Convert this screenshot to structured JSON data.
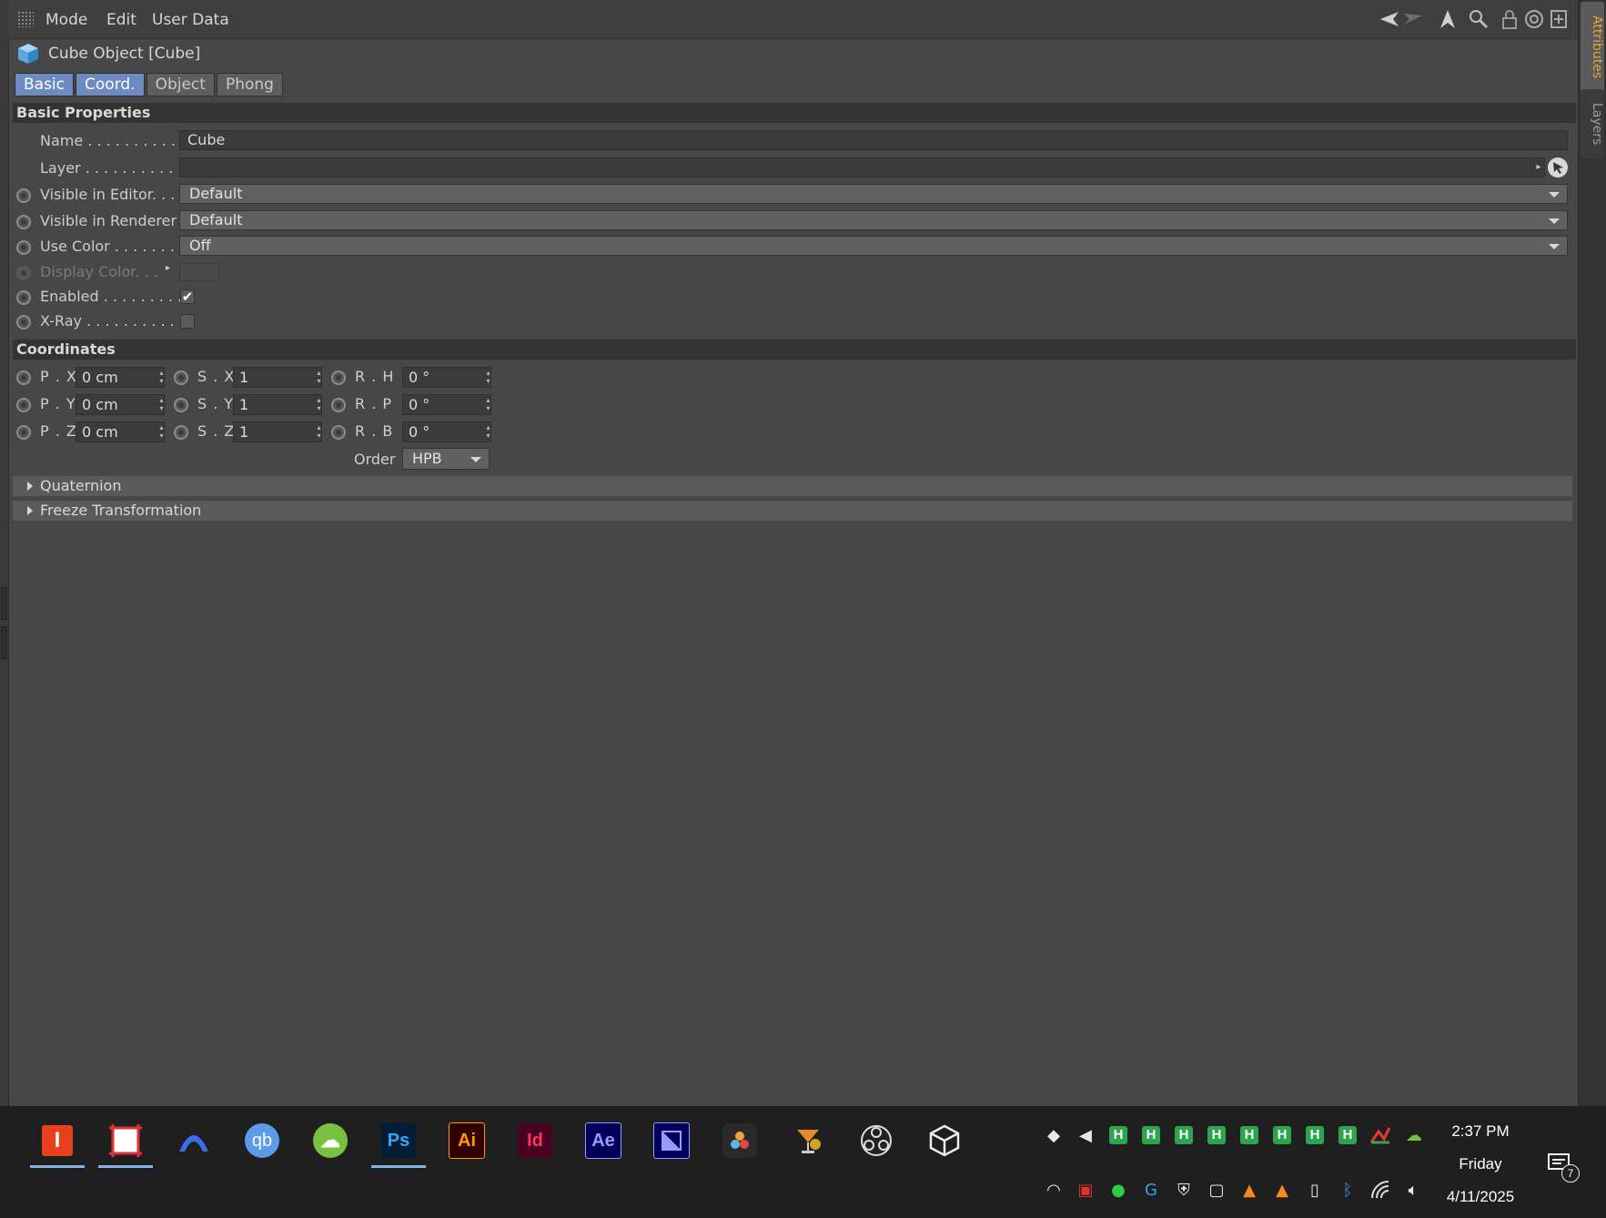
{
  "menu": {
    "items": [
      "Mode",
      "Edit",
      "User Data"
    ]
  },
  "toolbar_icons": [
    "back-arrow-icon",
    "forward-arrow-icon",
    "up-arrow-icon",
    "search-icon",
    "lock-icon",
    "target-icon",
    "new-panel-icon"
  ],
  "side_tabs": {
    "attributes": "Attributes",
    "layers": "Layers"
  },
  "object": {
    "title": "Cube Object [Cube]",
    "icon": "cube-icon"
  },
  "tabs": [
    "Basic",
    "Coord.",
    "Object",
    "Phong"
  ],
  "basic": {
    "header": "Basic Properties",
    "name_label": "Name . . . . . . . . . . .",
    "name_value": "Cube",
    "layer_label": "Layer . . . . . . . . . . . .",
    "layer_value": "",
    "visible_editor_label": "Visible in Editor. . .",
    "visible_editor_value": "Default",
    "visible_renderer_label": "Visible in Renderer",
    "visible_renderer_value": "Default",
    "use_color_label": "Use Color . . . . . . . .",
    "use_color_value": "Off",
    "display_color_label": "Display Color. . .",
    "enabled_label": "Enabled . . . . . . . . .",
    "enabled_checked": true,
    "xray_label": "X-Ray . . . . . . . . . . .",
    "xray_checked": false
  },
  "coords": {
    "header": "Coordinates",
    "position": [
      {
        "label": "P . X",
        "value": "0 cm"
      },
      {
        "label": "P . Y",
        "value": "0 cm"
      },
      {
        "label": "P . Z",
        "value": "0 cm"
      }
    ],
    "scale": [
      {
        "label": "S . X",
        "value": "1"
      },
      {
        "label": "S . Y",
        "value": "1"
      },
      {
        "label": "S . Z",
        "value": "1"
      }
    ],
    "rotation": [
      {
        "label": "R . H",
        "value": "0 °"
      },
      {
        "label": "R . P",
        "value": "0 °"
      },
      {
        "label": "R . B",
        "value": "0 °"
      }
    ],
    "order_label": "Order",
    "order_value": "HPB"
  },
  "groups": {
    "quaternion": "Quaternion",
    "freeze": "Freeze Transformation"
  },
  "taskbar": {
    "apps": [
      "indesign-red-icon",
      "snipping-tool-icon",
      "arc-app-icon",
      "qbittorrent-icon",
      "cloud-sync-icon",
      "photoshop-icon",
      "illustrator-icon",
      "indesign-icon",
      "after-effects-icon",
      "media-encoder-icon",
      "davinci-resolve-icon",
      "cocktail-app-icon",
      "obs-icon",
      "cube-app-icon"
    ],
    "app_labels": {
      "ps": "Ps",
      "ai": "Ai",
      "id": "Id",
      "ae": "Ae",
      "qb": "qb"
    },
    "clock": {
      "time": "2:37 PM",
      "day": "Friday",
      "date": "4/11/2025"
    },
    "notification_count": "7"
  }
}
